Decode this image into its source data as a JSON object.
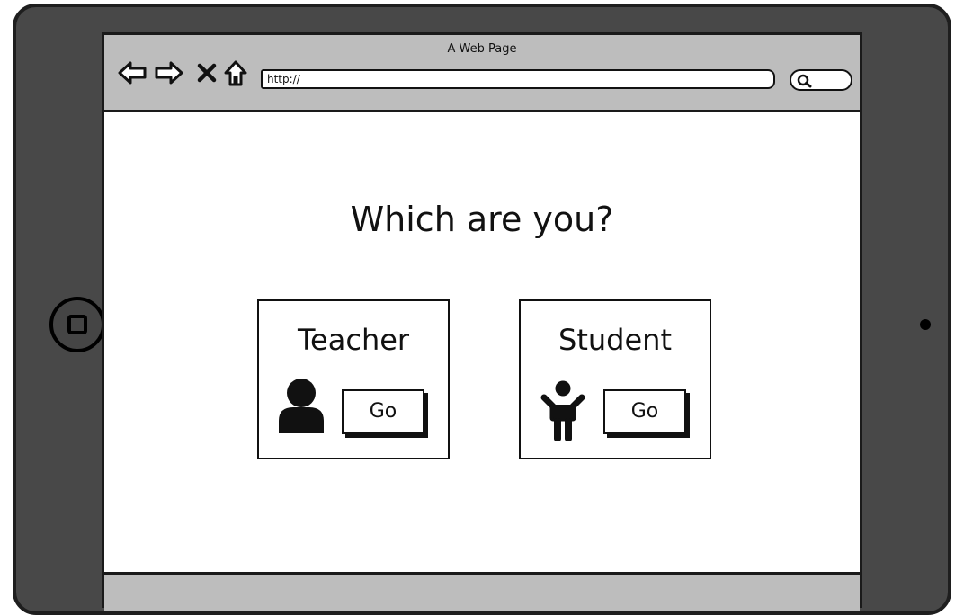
{
  "browser": {
    "page_title": "A Web Page",
    "url_value": "http://",
    "nav_icons": [
      "back-arrow-icon",
      "forward-arrow-icon",
      "close-icon",
      "home-icon"
    ],
    "search_icon": "search-icon"
  },
  "main": {
    "heading": "Which are you?",
    "cards": [
      {
        "title": "Teacher",
        "icon": "person-icon",
        "button_label": "Go"
      },
      {
        "title": "Student",
        "icon": "child-icon",
        "button_label": "Go"
      }
    ]
  },
  "colors": {
    "device_frame": "#484848",
    "browser_chrome": "#bdbdbd",
    "ink": "#111111"
  }
}
